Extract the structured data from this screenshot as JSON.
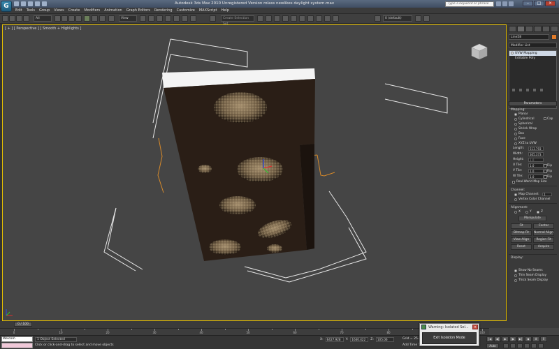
{
  "titlebar": {
    "window_title": "Autodesk 3ds Max  2010     Unregistered Version    rolass newlikes daylight system.max",
    "search_placeholder": "Type a keyword or phrase",
    "logo_text": "G"
  },
  "menu": {
    "items": [
      "Edit",
      "Tools",
      "Group",
      "Views",
      "Create",
      "Modifiers",
      "Animation",
      "Graph Editors",
      "Rendering",
      "Customize",
      "MAXScript",
      "Help"
    ]
  },
  "toolbar": {
    "selection_filter": "All",
    "ref_coord": "View",
    "named_selection_placeholder": "Create Selection Set",
    "layer": "0 (default)"
  },
  "viewport": {
    "label": "[ + ] [ Perspective ] [ Smooth + Highlights ]"
  },
  "command_panel": {
    "object_name": "Line58",
    "object_color": "#e07b2a",
    "modifier_list": "Modifier List",
    "stack": [
      {
        "label": "UVW Mapping",
        "selected": true
      },
      {
        "label": "Editable Poly",
        "selected": false
      }
    ],
    "parameters": {
      "rollout_title": "Parameters",
      "mapping_group": "Mapping:",
      "mapping_options": [
        {
          "label": "Planar",
          "on": true
        },
        {
          "label": "Cylindrical",
          "on": false
        },
        {
          "label": "Spherical",
          "on": false
        },
        {
          "label": "Shrink Wrap",
          "on": false
        },
        {
          "label": "Box",
          "on": false
        },
        {
          "label": "Face",
          "on": false
        },
        {
          "label": "XYZ to UVW",
          "on": false
        }
      ],
      "cap_label": "Cap",
      "length_label": "Length:",
      "length_value": "513.793",
      "width_label": "Width:",
      "width_value": "305.373",
      "height_label": "Height:",
      "height_value": "1.0",
      "utile_label": "U Tile:",
      "utile_value": "1.0",
      "vtile_label": "V Tile:",
      "vtile_value": "1.0",
      "wtile_label": "W Tile:",
      "wtile_value": "1.0",
      "flip_label": "Flip",
      "real_world": "Real-World Map Size",
      "channel_group": "Channel:",
      "map_channel": "Map Channel:",
      "map_channel_value": "1",
      "vertex_color_channel": "Vertex Color Channel",
      "alignment_group": "Alignment:",
      "axes": [
        "X",
        "Y",
        "Z"
      ],
      "manipulate": "Manipulate",
      "fit": "Fit",
      "center": "Center",
      "bitmap_fit": "Bitmap Fit",
      "normal_align": "Normal Align",
      "view_align": "View Align",
      "region_fit": "Region Fit",
      "reset": "Reset",
      "acquire": "Acquire",
      "display_group": "Display:",
      "show_no_seams": "Show No Seams",
      "thin_seam": "Thin Seam Display",
      "thick_seam": "Thick Seam Display"
    }
  },
  "timeline": {
    "slider": "0 / 100",
    "ticks": [
      "0",
      "10",
      "20",
      "30",
      "40",
      "50",
      "60",
      "70",
      "80",
      "90",
      "100"
    ]
  },
  "status": {
    "maxscript_text": "Welcom",
    "selection": "1 Object Selected",
    "prompt": "Click or click-and-drag to select and move objects",
    "x_label": "X:",
    "x_value": "6427.928",
    "y_label": "Y:",
    "y_value": "1640.422",
    "z_label": "Z:",
    "z_value": "105.06",
    "grid": "Grid = 25.4",
    "add_time_tag": "Add Time Tag"
  },
  "warning": {
    "title": "Warning: Isolated Sel...",
    "exit_button": "Exit Isolation Mode",
    "close": "×"
  }
}
